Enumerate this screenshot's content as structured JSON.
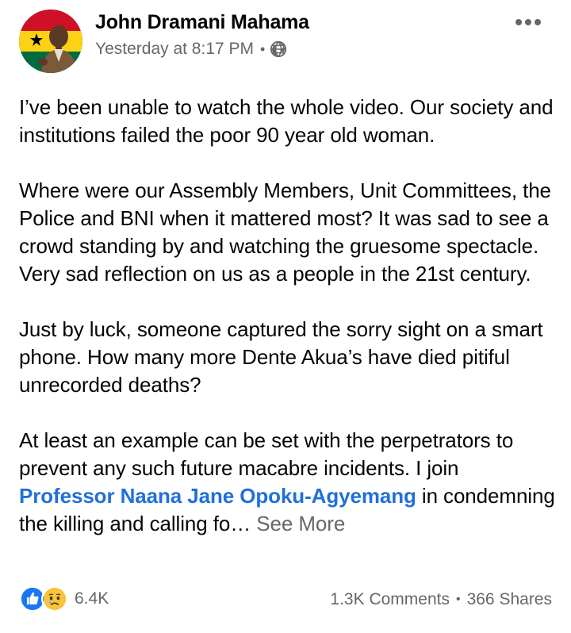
{
  "post": {
    "author": "John Dramani Mahama",
    "timestamp": "Yesterday at 8:17 PM",
    "separator": "•",
    "privacy_icon": "globe-icon",
    "more_icon": "more-options-icon",
    "paragraphs": [
      "I’ve been unable to watch the whole video. Our society and institutions failed the poor 90 year old woman.",
      "Where were our Assembly Members, Unit Committees, the Police and BNI when it mattered most? It was sad to see a crowd standing by and watching the gruesome spectacle. Very sad reflection on us as a people in the 21st century.",
      "Just by luck, someone captured the sorry sight on a smart phone. How many more Dente Akua’s have died pitiful unrecorded deaths?"
    ],
    "last_paragraph": {
      "before": "At least an example can be set with the perpetrators to prevent any such future macabre incidents. I join ",
      "mention": "Professor Naana Jane Opoku-Agyemang",
      "after": " in condemning the killing and calling fo… ",
      "see_more": "See More"
    }
  },
  "footer": {
    "reaction_icons": [
      "like-icon",
      "sad-icon"
    ],
    "reaction_count": "6.4K",
    "comments": "1.3K Comments",
    "separator": "•",
    "shares": "366 Shares"
  },
  "colors": {
    "text": "#050505",
    "secondary": "#65676b",
    "link": "#216fdb",
    "like_blue": "#1877f2",
    "sad_yellow": "#f7c53b"
  }
}
